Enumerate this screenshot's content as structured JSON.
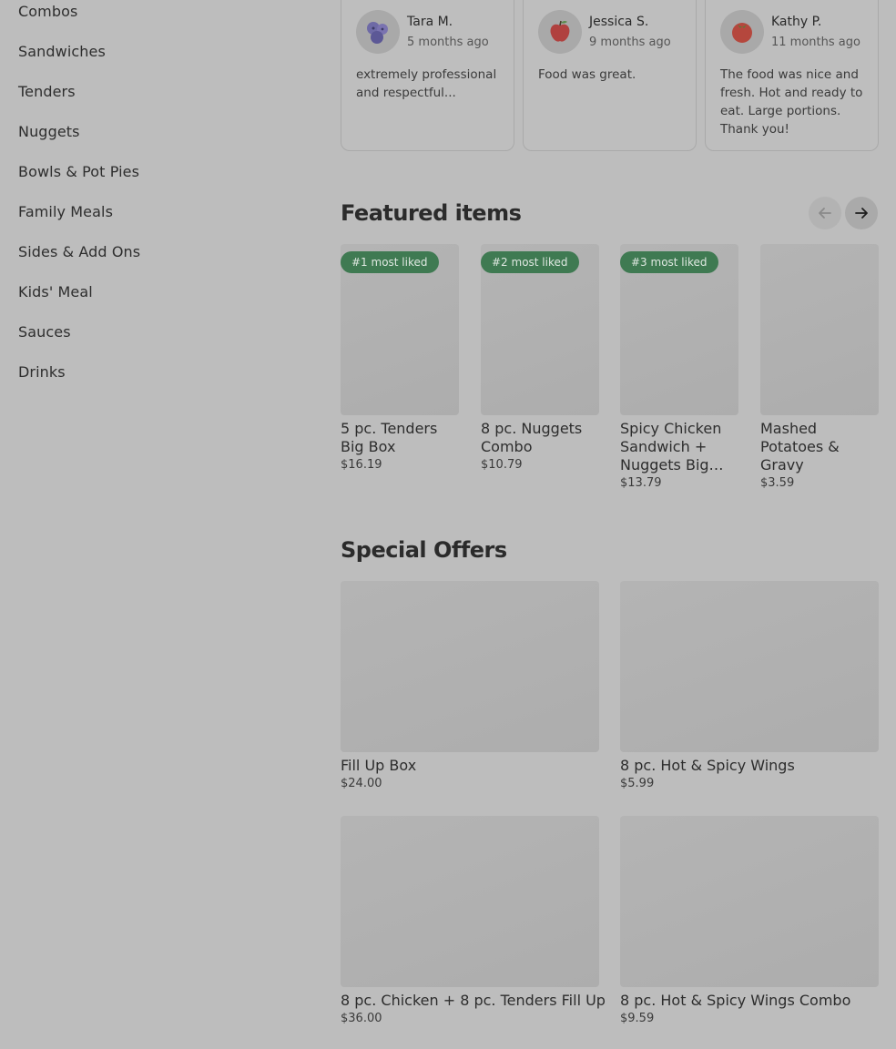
{
  "sidebar": {
    "items": [
      {
        "label": "Combos"
      },
      {
        "label": "Sandwiches"
      },
      {
        "label": "Tenders"
      },
      {
        "label": "Nuggets"
      },
      {
        "label": "Bowls & Pot Pies"
      },
      {
        "label": "Family Meals"
      },
      {
        "label": "Sides & Add Ons"
      },
      {
        "label": "Kids' Meal"
      },
      {
        "label": "Sauces"
      },
      {
        "label": "Drinks"
      }
    ]
  },
  "reviews": [
    {
      "name": "Tara M.",
      "time": "5 months ago",
      "text": "extremely professional and respectful...",
      "avatar_icon": "blueberry-icon"
    },
    {
      "name": "Jessica S.",
      "time": "9 months ago",
      "text": "Food was great.",
      "avatar_icon": "apple-icon"
    },
    {
      "name": "Kathy P.",
      "time": "11 months ago",
      "text": "The food was nice and fresh. Hot and ready to eat. Large portions. Thank you!",
      "avatar_icon": "tomato-icon"
    }
  ],
  "featured": {
    "title": "Featured items",
    "items": [
      {
        "badge": "#1 most liked",
        "name": "5 pc. Tenders Big Box",
        "price": "$16.19"
      },
      {
        "badge": "#2 most liked",
        "name": "8 pc. Nuggets Combo",
        "price": "$10.79"
      },
      {
        "badge": "#3 most liked",
        "name": "Spicy Chicken Sandwich + Nuggets Big Box",
        "price": "$13.79"
      },
      {
        "badge": "",
        "name": "Mashed Potatoes & Gravy",
        "price": "$3.59"
      }
    ]
  },
  "offers": {
    "title": "Special Offers",
    "items": [
      {
        "name": "Fill Up Box",
        "price": "$24.00"
      },
      {
        "name": "8 pc. Hot & Spicy Wings",
        "price": "$5.99"
      },
      {
        "name": "8 pc. Chicken + 8 pc. Tenders Fill Up",
        "price": "$36.00"
      },
      {
        "name": "8 pc. Hot & Spicy Wings Combo",
        "price": "$9.59"
      }
    ]
  },
  "colors": {
    "badge_bg": "#3f7a52",
    "background": "#bdbdbd"
  }
}
